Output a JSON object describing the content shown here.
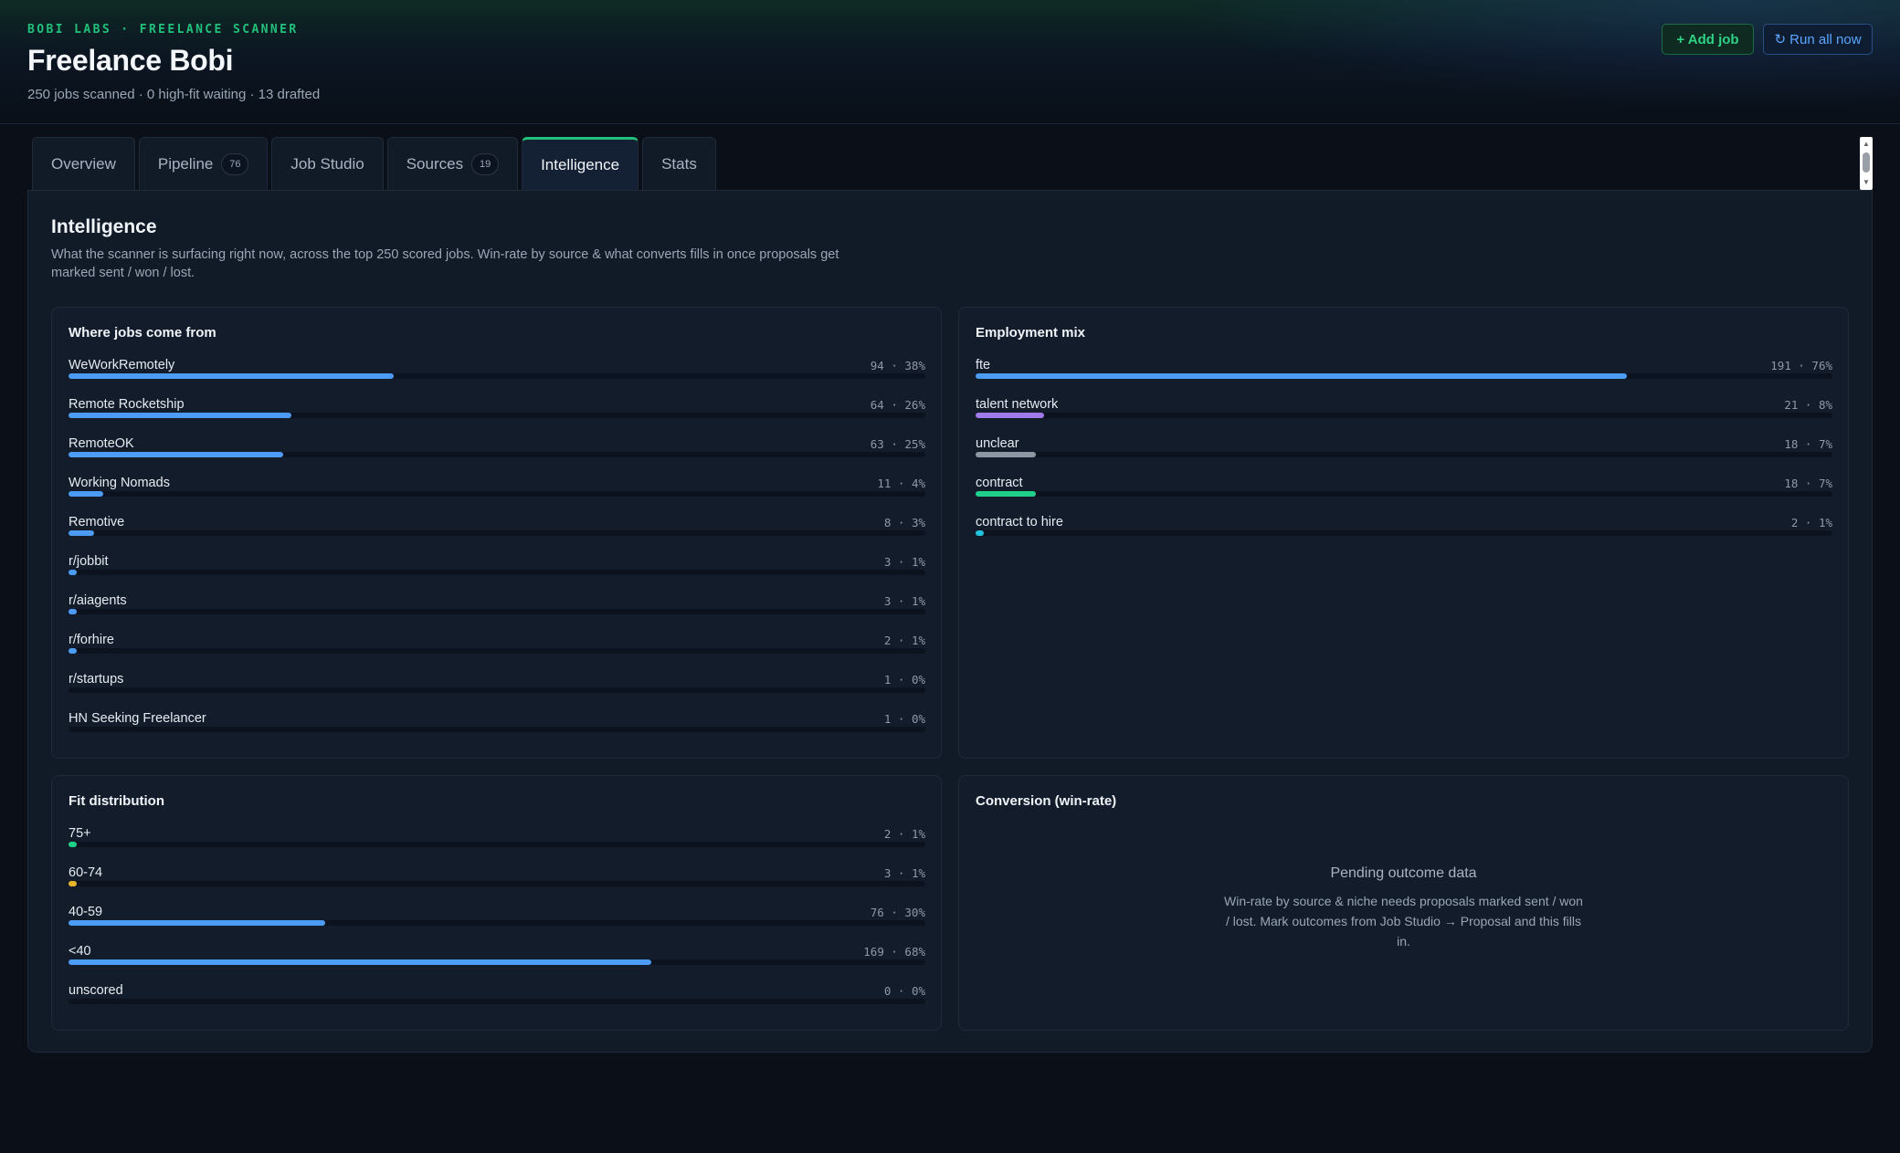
{
  "app": {
    "brand": "BOBI LABS · FREELANCE SCANNER",
    "title": "Freelance Bobi",
    "subtitle": "250 jobs scanned · 0 high-fit waiting · 13 drafted"
  },
  "actions": {
    "add_job": "+ Add job",
    "run_all": "↻ Run all now"
  },
  "tabs": [
    {
      "label": "Overview",
      "badge": null
    },
    {
      "label": "Pipeline",
      "badge": "76"
    },
    {
      "label": "Job Studio",
      "badge": null
    },
    {
      "label": "Sources",
      "badge": "19"
    },
    {
      "label": "Intelligence",
      "badge": null,
      "active": true
    },
    {
      "label": "Stats",
      "badge": null
    }
  ],
  "intelligence": {
    "title": "Intelligence",
    "description": "What the scanner is surfacing right now, across the top 250 scored jobs. Win-rate by source & what converts fills in once proposals get marked sent / won / lost.",
    "sources": {
      "title": "Where jobs come from",
      "rows": [
        {
          "label": "WeWorkRemotely",
          "value": "94 · 38%",
          "fraction": 0.38,
          "color": "#4c9bf5"
        },
        {
          "label": "Remote Rocketship",
          "value": "64 · 26%",
          "fraction": 0.26,
          "color": "#4c9bf5"
        },
        {
          "label": "RemoteOK",
          "value": "63 · 25%",
          "fraction": 0.25,
          "color": "#4c9bf5"
        },
        {
          "label": "Working Nomads",
          "value": "11 · 4%",
          "fraction": 0.04,
          "color": "#4c9bf5"
        },
        {
          "label": "Remotive",
          "value": "8 · 3%",
          "fraction": 0.03,
          "color": "#4c9bf5"
        },
        {
          "label": "r/jobbit",
          "value": "3 · 1%",
          "fraction": 0.01,
          "color": "#4c9bf5"
        },
        {
          "label": "r/aiagents",
          "value": "3 · 1%",
          "fraction": 0.01,
          "color": "#4c9bf5"
        },
        {
          "label": "r/forhire",
          "value": "2 · 1%",
          "fraction": 0.01,
          "color": "#4c9bf5"
        },
        {
          "label": "r/startups",
          "value": "1 · 0%",
          "fraction": 0,
          "color": "#4c9bf5"
        },
        {
          "label": "HN Seeking Freelancer",
          "value": "1 · 0%",
          "fraction": 0,
          "color": "#4c9bf5"
        }
      ]
    },
    "employment": {
      "title": "Employment mix",
      "rows": [
        {
          "label": "fte",
          "value": "191 · 76%",
          "fraction": 0.76,
          "color": "#4c9bf5"
        },
        {
          "label": "talent network",
          "value": "21 · 8%",
          "fraction": 0.08,
          "color": "#a07be8"
        },
        {
          "label": "unclear",
          "value": "18 · 7%",
          "fraction": 0.07,
          "color": "#8d96a3"
        },
        {
          "label": "contract",
          "value": "18 · 7%",
          "fraction": 0.07,
          "color": "#1fcf8a"
        },
        {
          "label": "contract to hire",
          "value": "2 · 1%",
          "fraction": 0.01,
          "color": "#22c3e0"
        }
      ]
    },
    "fit": {
      "title": "Fit distribution",
      "rows": [
        {
          "label": "75+",
          "value": "2 · 1%",
          "fraction": 0.01,
          "color": "#1fcf8a"
        },
        {
          "label": "60-74",
          "value": "3 · 1%",
          "fraction": 0.01,
          "color": "#e8b42a"
        },
        {
          "label": "40-59",
          "value": "76 · 30%",
          "fraction": 0.3,
          "color": "#4c9bf5"
        },
        {
          "label": "<40",
          "value": "169 · 68%",
          "fraction": 0.68,
          "color": "#4c9bf5"
        },
        {
          "label": "unscored",
          "value": "0 · 0%",
          "fraction": 0,
          "color": "#4c9bf5"
        }
      ]
    },
    "conversion": {
      "title": "Conversion (win-rate)",
      "pending_title": "Pending outcome data",
      "pending_text": "Win-rate by source & niche needs proposals marked sent / won / lost. Mark outcomes from Job Studio → Proposal and this fills in."
    }
  }
}
